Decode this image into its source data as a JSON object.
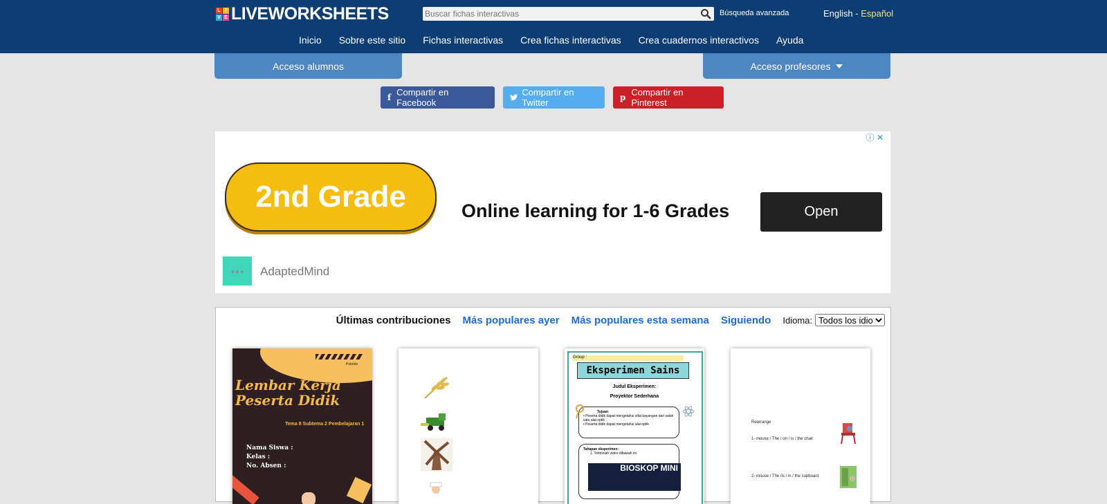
{
  "header": {
    "logo_text": "LIVEWORKSHEETS",
    "logo_letters": [
      "L",
      "I",
      "V",
      "E"
    ],
    "search_placeholder": "Buscar fichas interactivas",
    "advanced_search": "Búsqueda avanzada",
    "lang_en": "English",
    "lang_sep": " - ",
    "lang_es": "Español",
    "nav": [
      "Inicio",
      "Sobre este sitio",
      "Fichas interactivas",
      "Crea fichas interactivas",
      "Crea cuadernos interactivos",
      "Ayuda"
    ]
  },
  "access": {
    "students": "Acceso alumnos",
    "teachers": "Acceso profesores"
  },
  "share": {
    "facebook": "Compartir en Facebook",
    "twitter": "Compartir en Twitter",
    "pinterest": "Compartir en Pinterest"
  },
  "ad": {
    "badge": "2nd Grade",
    "headline": "Online learning for 1-6 Grades",
    "cta": "Open",
    "brand": "AdaptedMind",
    "info": "ⓘ ✕"
  },
  "contributions": {
    "tabs": [
      "Últimas contribuciones",
      "Más populares ayer",
      "Más populares esta semana",
      "Siguiendo"
    ],
    "idioma_label": "Idioma:",
    "idioma_selected": "Todos los idiomas"
  },
  "cards": {
    "c1": {
      "brand": "Pubride",
      "title_line1": "Lembar Kerja",
      "title_line2": "Peserta Didik",
      "subtitle": "Tema 8 Subtema 2 Pembelajaran 1",
      "fields": [
        "Nama Siswa  :",
        "Kelas          :",
        "No. Absen    :"
      ]
    },
    "c3": {
      "group": "Group :",
      "title": "Eksperimen Sains",
      "sub1": "Judul Eksperimen:",
      "sub2": "Proyektor Sederhana",
      "tujuan": "Tujuan",
      "tujuan_items": [
        "• Peserta didik dapat mengetahui sifat bayangan dari salah satu alat optik",
        "• Peserta didik dapat mengetahui alat optik"
      ],
      "tahapan": "Tahapan eksperimen:",
      "tahapan_item": "1. Tontonlah video dibawah ini",
      "img_text": "BIOSKOP MINI"
    },
    "c4": {
      "heading": "Rearrange",
      "line1": "1- mouse  /  The  / on  /  is  /  the chair",
      "line2": "2- mouse  /  The  /is  / in  /  the cupboard"
    }
  },
  "colors": {
    "header_bg": "#0d3d73",
    "access_btn": "#4e86c4",
    "facebook": "#3b5998",
    "twitter": "#55acee",
    "pinterest": "#cb2027",
    "link_blue": "#1a6fd6"
  }
}
